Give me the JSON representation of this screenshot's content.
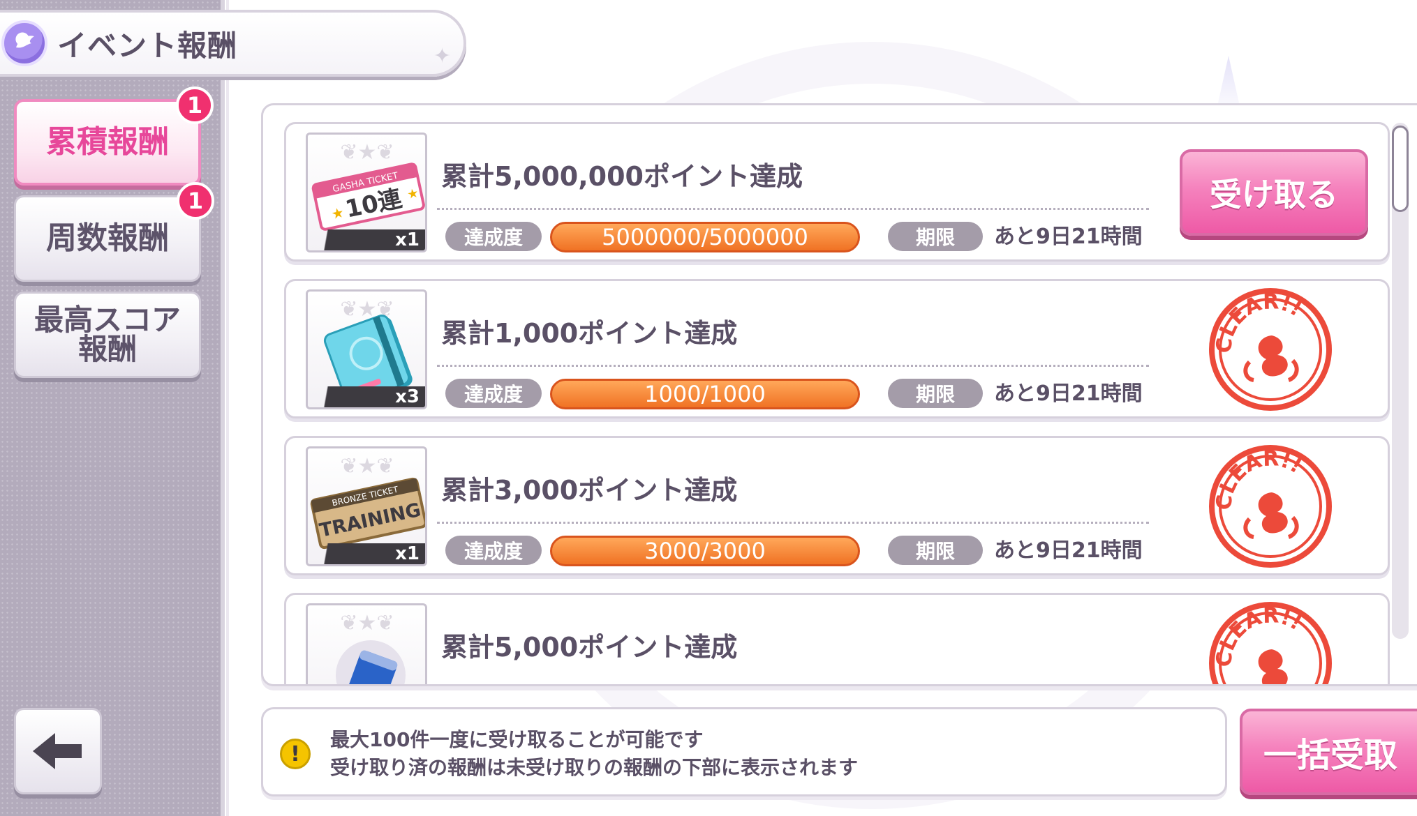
{
  "header": {
    "title": "イベント報酬"
  },
  "sidebar": {
    "tabs": [
      {
        "label": "累積報酬",
        "badge": "1",
        "active": true
      },
      {
        "label": "周数報酬",
        "badge": "1",
        "active": false
      },
      {
        "label_line1": "最高スコア",
        "label_line2": "報酬",
        "active": false
      }
    ]
  },
  "rewards": {
    "progress_label": "達成度",
    "deadline_label": "期限",
    "receive_label": "受け取る",
    "stamp_text": "CLEAR!!",
    "items": [
      {
        "title": "累計5,000,000ポイント達成",
        "item": "gasha-ticket-10",
        "item_text_top": "GASHA TICKET",
        "item_text_main": "10連",
        "quantity": "x1",
        "progress": "5000000/5000000",
        "deadline": "あと9日21時間",
        "state": "receivable"
      },
      {
        "title": "累計1,000ポイント達成",
        "item": "notebook",
        "quantity": "x3",
        "progress": "1000/1000",
        "deadline": "あと9日21時間",
        "state": "cleared"
      },
      {
        "title": "累計3,000ポイント達成",
        "item": "bronze-training-ticket",
        "item_text_top": "BRONZE TICKET",
        "item_text_main": "TRAINING",
        "quantity": "x1",
        "progress": "3000/3000",
        "deadline": "あと9日21時間",
        "state": "cleared"
      },
      {
        "title": "累計5,000ポイント達成",
        "item": "drink-can",
        "state": "cleared"
      }
    ]
  },
  "info": {
    "line1": "最大100件一度に受け取ることが可能です",
    "line2": "受け取り済の報酬は未受け取りの報酬の下部に表示されます"
  },
  "bulk_button": {
    "label": "一括受取"
  },
  "colors": {
    "accent_pink": "#ee5aa6",
    "progress_orange": "#f07224",
    "stamp_red": "#ec4a3a",
    "sidebar_bg": "#b3abbc"
  }
}
